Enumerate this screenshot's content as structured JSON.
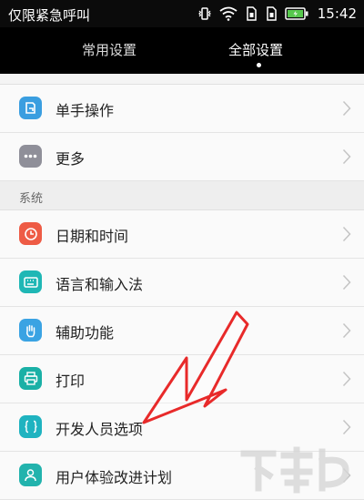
{
  "status_bar": {
    "carrier": "仅限紧急呼叫",
    "time": "15:42"
  },
  "tabs": [
    {
      "label": "常用设置",
      "active": false
    },
    {
      "label": "全部设置",
      "active": true
    }
  ],
  "rows_top": [
    {
      "label": "单手操作",
      "icon": "one-hand-icon",
      "color": "#3a9ee0"
    },
    {
      "label": "更多",
      "icon": "more-icon",
      "color": "#8f8f99"
    }
  ],
  "section_system": "系统",
  "rows_system": [
    {
      "label": "日期和时间",
      "icon": "clock-icon",
      "color": "#ee5b45"
    },
    {
      "label": "语言和输入法",
      "icon": "keyboard-icon",
      "color": "#1fb7b5"
    },
    {
      "label": "辅助功能",
      "icon": "hand-icon",
      "color": "#3aa3e3"
    },
    {
      "label": "打印",
      "icon": "printer-icon",
      "color": "#1ab0a6"
    },
    {
      "label": "开发人员选项",
      "icon": "braces-icon",
      "color": "#1fb3c0"
    },
    {
      "label": "用户体验改进计划",
      "icon": "user-icon",
      "color": "#22b3ad"
    }
  ],
  "annotation_color": "#e82a2a"
}
